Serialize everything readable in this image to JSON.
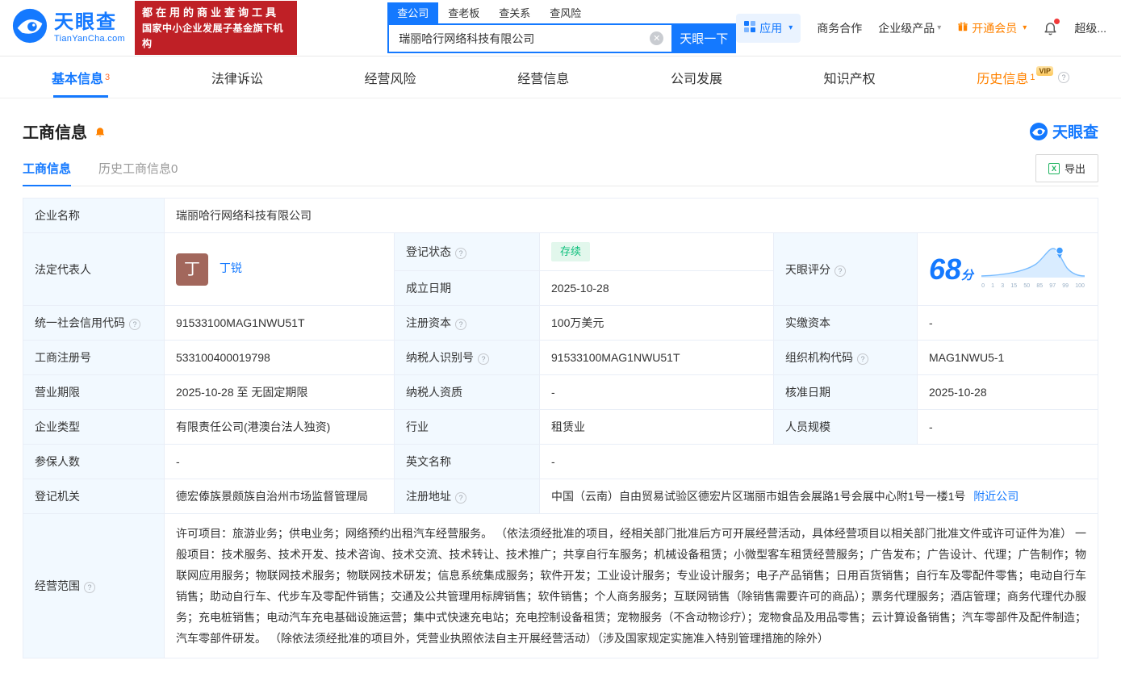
{
  "colors": {
    "brand_blue": "#1479ff",
    "badge_red": "#bf2026",
    "vip_orange": "#ff8200",
    "status_green": "#0dbf7c"
  },
  "icons": {
    "clear": "✕",
    "caret": "▾",
    "help": "?",
    "excel": "X"
  },
  "brand": {
    "name": "天眼查",
    "domain": "TianYanCha.com",
    "slogan1": "都在用的商业查询工具",
    "slogan2": "国家中小企业发展子基金旗下机构"
  },
  "search": {
    "tabs": [
      "查公司",
      "查老板",
      "查关系",
      "查风险"
    ],
    "value": "瑞丽哈行网络科技有限公司",
    "button": "天眼一下"
  },
  "topnav": {
    "apps": "应用",
    "cooperation": "商务合作",
    "enterprise": "企业级产品",
    "member": "开通会员",
    "super": "超级..."
  },
  "tabs": {
    "basic": "基本信息",
    "basic_count": "3",
    "legal": "法律诉讼",
    "risk": "经营风险",
    "operation": "经营信息",
    "development": "公司发展",
    "ip": "知识产权",
    "history": "历史信息",
    "history_count": "1",
    "history_vip": "VIP"
  },
  "section": {
    "title": "工商信息",
    "subtab_current": "工商信息",
    "subtab_history": "历史工商信息0",
    "export": "导出",
    "brand": "天眼查"
  },
  "score": {
    "value": "68",
    "unit": "分",
    "axis": [
      "0",
      "1",
      "3",
      "15",
      "50",
      "85",
      "97",
      "99",
      "100"
    ]
  },
  "fields": {
    "name": {
      "label": "企业名称",
      "value": "瑞丽哈行网络科技有限公司"
    },
    "legal_rep": {
      "label": "法定代表人",
      "avatar": "丁",
      "value": "丁锐"
    },
    "reg_status": {
      "label": "登记状态",
      "value": "存续"
    },
    "establish_date": {
      "label": "成立日期",
      "value": "2025-10-28"
    },
    "score_label": {
      "label": "天眼评分"
    },
    "credit_code": {
      "label": "统一社会信用代码",
      "value": "91533100MAG1NWU51T"
    },
    "reg_capital": {
      "label": "注册资本",
      "value": "100万美元"
    },
    "paid_capital": {
      "label": "实缴资本",
      "value": "-"
    },
    "reg_number": {
      "label": "工商注册号",
      "value": "533100400019798"
    },
    "taxpayer_id": {
      "label": "纳税人识别号",
      "value": "91533100MAG1NWU51T"
    },
    "org_code": {
      "label": "组织机构代码",
      "value": "MAG1NWU5-1"
    },
    "business_term": {
      "label": "营业期限",
      "value": "2025-10-28 至 无固定期限"
    },
    "taxpayer_quality": {
      "label": "纳税人资质",
      "value": "-"
    },
    "approval_date": {
      "label": "核准日期",
      "value": "2025-10-28"
    },
    "company_type": {
      "label": "企业类型",
      "value": "有限责任公司(港澳台法人独资)"
    },
    "industry": {
      "label": "行业",
      "value": "租赁业"
    },
    "staff_size": {
      "label": "人员规模",
      "value": "-"
    },
    "insured_count": {
      "label": "参保人数",
      "value": "-"
    },
    "english_name": {
      "label": "英文名称",
      "value": "-"
    },
    "reg_authority": {
      "label": "登记机关",
      "value": "德宏傣族景颇族自治州市场监督管理局"
    },
    "reg_address": {
      "label": "注册地址",
      "value": "中国（云南）自由贸易试验区德宏片区瑞丽市姐告会展路1号会展中心附1号一楼1号",
      "link": "附近公司"
    },
    "business_scope": {
      "label": "经营范围",
      "value": "许可项目：旅游业务；供电业务；网络预约出租汽车经营服务。 （依法须经批准的项目，经相关部门批准后方可开展经营活动，具体经营项目以相关部门批准文件或许可证件为准） 一般项目：技术服务、技术开发、技术咨询、技术交流、技术转让、技术推广；共享自行车服务；机械设备租赁；小微型客车租赁经营服务；广告发布；广告设计、代理；广告制作；物联网应用服务；物联网技术服务；物联网技术研发；信息系统集成服务；软件开发；工业设计服务；专业设计服务；电子产品销售；日用百货销售；自行车及零配件零售；电动自行车销售；助动自行车、代步车及零配件销售；交通及公共管理用标牌销售；软件销售；个人商务服务；互联网销售（除销售需要许可的商品）；票务代理服务；酒店管理；商务代理代办服务；充电桩销售；电动汽车充电基础设施运营；集中式快速充电站；充电控制设备租赁；宠物服务（不含动物诊疗）；宠物食品及用品零售；云计算设备销售；汽车零部件及配件制造；汽车零部件研发。 （除依法须经批准的项目外，凭营业执照依法自主开展经营活动）（涉及国家规定实施准入特别管理措施的除外）"
    }
  }
}
